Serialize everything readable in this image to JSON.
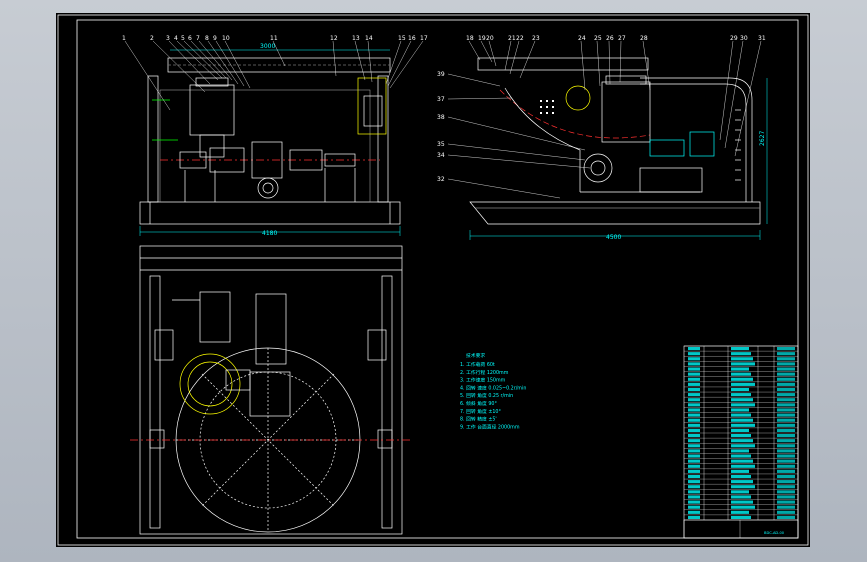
{
  "front_view": {
    "part_labels": [
      "1",
      "2",
      "3",
      "4",
      "5",
      "6",
      "7",
      "8",
      "9",
      "10",
      "11",
      "12",
      "13",
      "14",
      "15",
      "16",
      "17"
    ],
    "dim_width": "4180",
    "dim_top": "3000"
  },
  "side_view": {
    "part_labels_top": [
      "18",
      "19",
      "20",
      "21",
      "22",
      "23",
      "24",
      "25",
      "26",
      "27",
      "28",
      "29",
      "30",
      "31"
    ],
    "part_labels_left": [
      "39",
      "37",
      "38",
      "35",
      "34",
      "32"
    ],
    "dim_width": "4500",
    "dim_height": "2627"
  },
  "tech_notes": {
    "title": "技术要求",
    "lines": [
      "1. 工作载荷 60t",
      "2. 工作行程 1200mm",
      "3. 工作速度 150mm",
      "4. 回转 速度 0.025~0.2r/min",
      "5. 回转 角度 0.25 r/min",
      "6. 倾斜 角度 90°",
      "7. 回转 角度 ±10°",
      "8. 回转 精度 ±5'",
      "9. 工作 台面直径 2000mm"
    ]
  },
  "title_block": {
    "rows": 34,
    "footer": "BDC-AD-00"
  }
}
